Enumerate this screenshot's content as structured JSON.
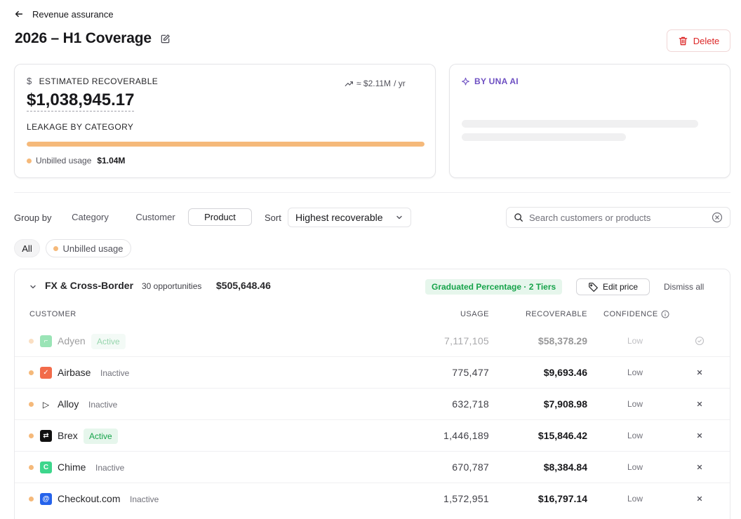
{
  "header": {
    "back_label": "Revenue assurance",
    "title": "2026 – H1 Coverage",
    "delete_label": "Delete"
  },
  "estimate": {
    "label": "ESTIMATED RECOVERABLE",
    "value": "$1,038,945.17",
    "annualized": "≈ $2.11M",
    "annualized_unit": "/ yr",
    "leakage_label": "LEAKAGE BY CATEGORY",
    "categories": [
      {
        "name": "Unbilled usage",
        "amount": "$1.04M",
        "share": 1.0,
        "color": "#f5b97a"
      }
    ]
  },
  "ai": {
    "label": "BY UNA AI"
  },
  "toolbar": {
    "group_by_label": "Group by",
    "group_options": [
      "Category",
      "Customer",
      "Product"
    ],
    "group_selected": "Product",
    "sort_label": "Sort",
    "sort_value": "Highest recoverable",
    "search_placeholder": "Search customers or products"
  },
  "filters": {
    "all": "All",
    "unbilled": "Unbilled usage"
  },
  "group": {
    "title": "FX & Cross-Border",
    "count": "30 opportunities",
    "amount": "$505,648.46",
    "pricing_badge": "Graduated Percentage · 2 Tiers",
    "edit_price": "Edit price",
    "dismiss_all": "Dismiss all",
    "columns": {
      "customer": "CUSTOMER",
      "usage": "USAGE",
      "recoverable": "RECOVERABLE",
      "confidence": "CONFIDENCE"
    },
    "rows": [
      {
        "name": "Adyen",
        "status": "Active",
        "usage": "7,117,105",
        "recoverable": "$58,378.29",
        "confidence": "Low",
        "faded": true,
        "logo_color": "#22c55e",
        "logo_glyph": "⌐"
      },
      {
        "name": "Airbase",
        "status": "Inactive",
        "usage": "775,477",
        "recoverable": "$9,693.46",
        "confidence": "Low",
        "faded": false,
        "logo_color": "#f26b4a",
        "logo_glyph": "✓"
      },
      {
        "name": "Alloy",
        "status": "Inactive",
        "usage": "632,718",
        "recoverable": "$7,908.98",
        "confidence": "Low",
        "faded": false,
        "logo_color": "#ffffff",
        "logo_glyph": "▷"
      },
      {
        "name": "Brex",
        "status": "Active",
        "usage": "1,446,189",
        "recoverable": "$15,846.42",
        "confidence": "Low",
        "faded": false,
        "logo_color": "#111111",
        "logo_glyph": "⇄"
      },
      {
        "name": "Chime",
        "status": "Inactive",
        "usage": "670,787",
        "recoverable": "$8,384.84",
        "confidence": "Low",
        "faded": false,
        "logo_color": "#3dd68c",
        "logo_glyph": "C"
      },
      {
        "name": "Checkout.com",
        "status": "Inactive",
        "usage": "1,572,951",
        "recoverable": "$16,797.14",
        "confidence": "Low",
        "faded": false,
        "logo_color": "#2563eb",
        "logo_glyph": "@"
      }
    ]
  }
}
